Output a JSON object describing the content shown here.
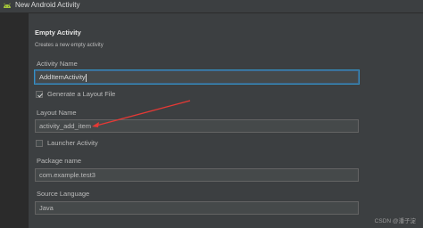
{
  "window": {
    "title": "New Android Activity",
    "icon": "android-icon"
  },
  "form": {
    "heading": "Empty Activity",
    "subtitle": "Creates a new empty activity",
    "activity_name_label": "Activity Name",
    "activity_name_value": "AddItemActivity",
    "generate_layout_label": "Generate a Layout File",
    "generate_layout_checked": true,
    "layout_name_label": "Layout Name",
    "layout_name_value": "activity_add_item",
    "launcher_activity_label": "Launcher Activity",
    "launcher_activity_checked": false,
    "package_name_label": "Package name",
    "package_name_value": "com.example.test3",
    "source_language_label": "Source Language",
    "source_language_value": "Java"
  },
  "annotation": {
    "arrow_color": "#e53935"
  },
  "watermark": "CSDN @潘子淀",
  "colors": {
    "background": "#3c3f41",
    "focus_border": "#3592c4",
    "arrow": "#e53935"
  }
}
